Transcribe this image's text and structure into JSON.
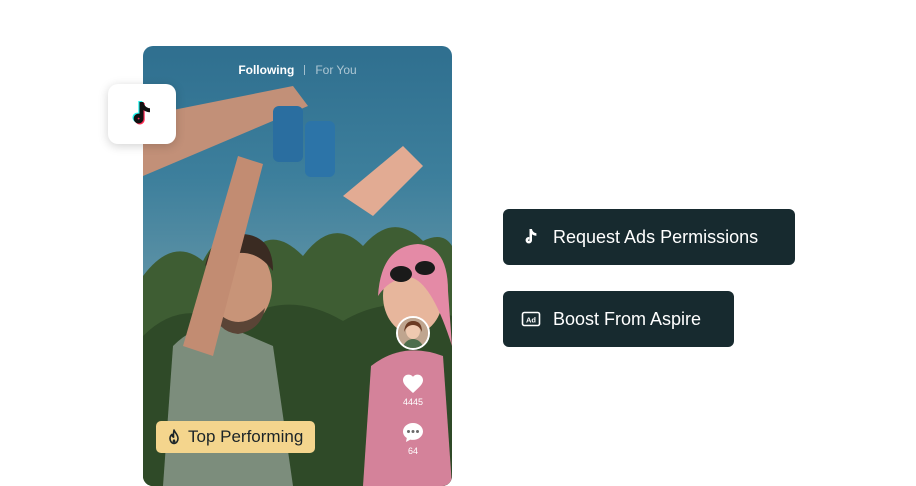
{
  "feed": {
    "tab_following": "Following",
    "tab_for_you": "For You"
  },
  "badge": {
    "label": "Top Performing",
    "icon": "fire-icon",
    "color": "#f4d58d"
  },
  "side_actions": {
    "likes": "4445",
    "comments": "64"
  },
  "buttons": {
    "request_ads_label": "Request Ads Permissions",
    "request_ads_icon": "tiktok-icon",
    "boost_label": "Boost From Aspire",
    "boost_icon": "ad-icon",
    "color": "#172a2f"
  },
  "app_tile": {
    "icon": "tiktok-logo-icon"
  }
}
